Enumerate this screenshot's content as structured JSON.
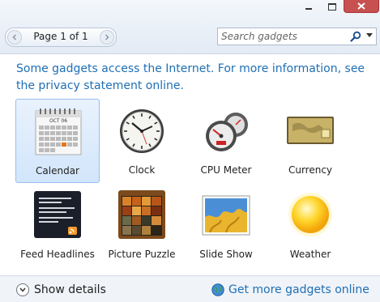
{
  "toolbar": {
    "page_label": "Page 1 of 1",
    "search_placeholder": "Search gadgets"
  },
  "notice": "Some gadgets access the Internet.  For more information, see the privacy statement online.",
  "gadgets": [
    {
      "label": "Calendar",
      "icon": "calendar-icon",
      "selected": true
    },
    {
      "label": "Clock",
      "icon": "clock-icon",
      "selected": false
    },
    {
      "label": "CPU Meter",
      "icon": "cpu-meter-icon",
      "selected": false
    },
    {
      "label": "Currency",
      "icon": "currency-icon",
      "selected": false
    },
    {
      "label": "Feed Headlines",
      "icon": "feed-headlines-icon",
      "selected": false
    },
    {
      "label": "Picture Puzzle",
      "icon": "picture-puzzle-icon",
      "selected": false
    },
    {
      "label": "Slide Show",
      "icon": "slide-show-icon",
      "selected": false
    },
    {
      "label": "Weather",
      "icon": "weather-icon",
      "selected": false
    }
  ],
  "calendar_month": "OCT 06",
  "footer": {
    "show_details": "Show details",
    "get_more": "Get more gadgets online"
  },
  "colors": {
    "link": "#1e6fb5",
    "selection": "#d2e5fb",
    "close_button": "#c75050"
  }
}
